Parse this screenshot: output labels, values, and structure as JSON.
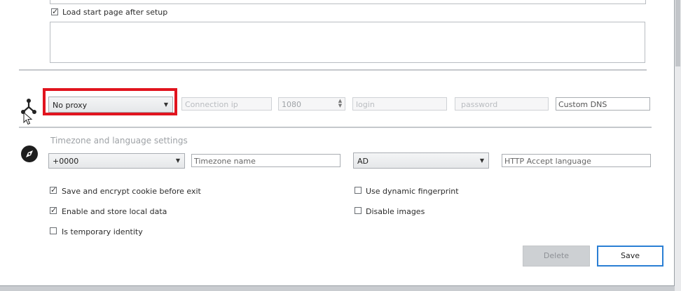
{
  "startup": {
    "load_start_page_label": "Load start page after setup",
    "load_start_page_checked": true
  },
  "proxy": {
    "type_selected": "No proxy",
    "connection_ip_placeholder": "Connection ip",
    "port_value": "1080",
    "login_placeholder": "login",
    "password_placeholder": "password",
    "custom_dns_placeholder": "Custom DNS"
  },
  "timezone": {
    "section_title": "Timezone and language settings",
    "offset_selected": "+0000",
    "timezone_name_placeholder": "Timezone name",
    "language_selected": "AD",
    "accept_language_placeholder": "HTTP Accept language"
  },
  "options": {
    "save_cookie_label": "Save and encrypt cookie before exit",
    "save_cookie_checked": true,
    "local_data_label": "Enable and store local data",
    "local_data_checked": true,
    "temporary_label": "Is temporary identity",
    "temporary_checked": false,
    "dynamic_fp_label": "Use dynamic fingerprint",
    "dynamic_fp_checked": false,
    "disable_images_label": "Disable images",
    "disable_images_checked": false
  },
  "buttons": {
    "delete_label": "Delete",
    "save_label": "Save"
  },
  "colors": {
    "highlight": "#e1141e",
    "accent": "#2a7fd4"
  },
  "icons": {
    "proxy": "proxy-network-icon",
    "timezone": "compass-icon",
    "cursor": "mouse-pointer-icon"
  }
}
